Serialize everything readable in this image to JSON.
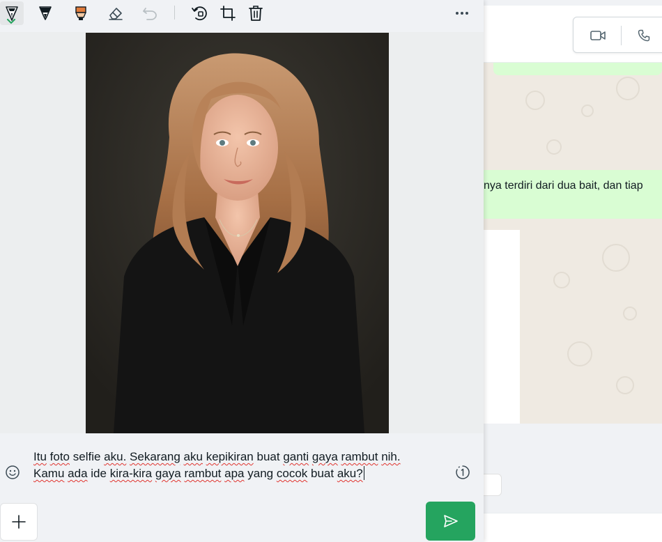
{
  "app": {
    "toolbar": {
      "tools": [
        {
          "icon": "pen-thin-icon"
        },
        {
          "icon": "pen-thick-icon"
        },
        {
          "icon": "highlighter-icon"
        },
        {
          "icon": "eraser-icon"
        },
        {
          "icon": "undo-icon"
        },
        {
          "icon": "rotate-icon"
        },
        {
          "icon": "crop-icon"
        },
        {
          "icon": "delete-icon"
        },
        {
          "icon": "more-options-icon"
        }
      ]
    },
    "caption": {
      "line1_words": [
        "Itu",
        "foto",
        "selfie",
        "aku.",
        "Sekarang",
        "aku",
        "kepikiran",
        "buat",
        "ganti",
        "gaya",
        "rambut",
        "nih."
      ],
      "line2_words": [
        "Kamu",
        "ada",
        "ide",
        "kira-kira",
        "gaya",
        "rambut",
        "apa",
        "yang",
        "cocok",
        "buat",
        "aku?"
      ]
    },
    "background_chat": {
      "visible_message_fragment": "knya terdiri dari dua bait, dan tiap"
    },
    "colors": {
      "accent_send": "#25a45f",
      "outgoing_bubble": "#d9fdd3",
      "chat_wallpaper": "#efeae2",
      "spellcheck": "#e0332d"
    }
  }
}
